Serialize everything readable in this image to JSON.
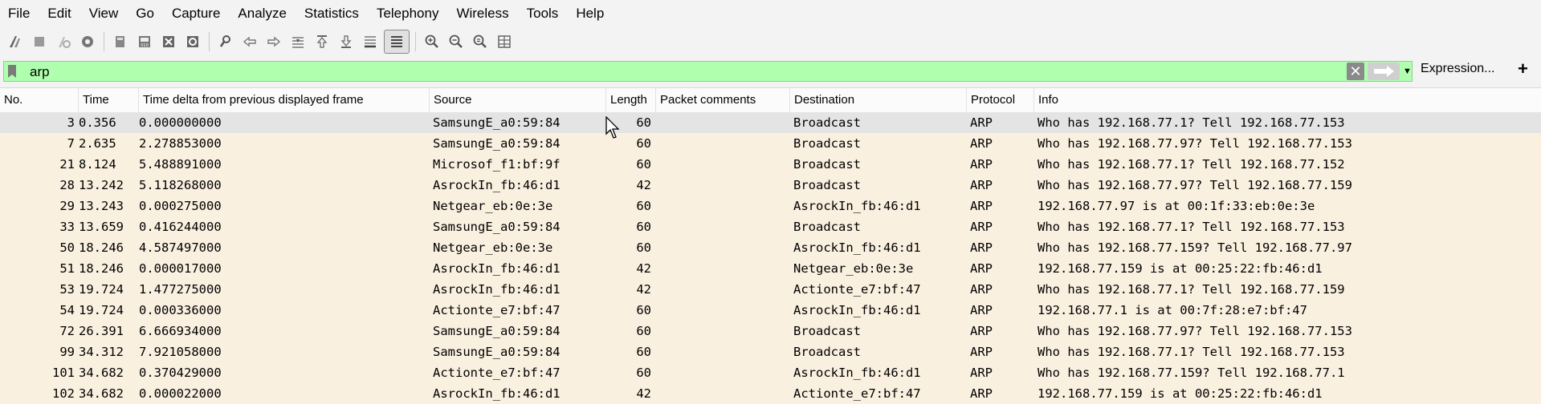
{
  "menu": [
    "File",
    "Edit",
    "View",
    "Go",
    "Capture",
    "Analyze",
    "Statistics",
    "Telephony",
    "Wireless",
    "Tools",
    "Help"
  ],
  "toolbar": {
    "icons": [
      "start-capture-icon",
      "stop-capture-icon",
      "restart-capture-icon",
      "capture-options-icon",
      "open-file-icon",
      "save-file-icon",
      "close-file-icon",
      "reload-file-icon",
      "find-packet-icon",
      "go-back-icon",
      "go-forward-icon",
      "go-to-packet-icon",
      "first-packet-icon",
      "last-packet-icon",
      "auto-scroll-icon",
      "colorize-icon",
      "zoom-in-icon",
      "zoom-out-icon",
      "normal-size-icon",
      "resize-columns-icon"
    ]
  },
  "filter": {
    "value": "arp",
    "expression_label": "Expression...",
    "add_label": "+",
    "clear_label": "✕",
    "background": "#afffaf"
  },
  "columns": {
    "no": "No.",
    "time": "Time",
    "delta": "Time delta from previous displayed frame",
    "source": "Source",
    "length": "Length",
    "comments": "Packet comments",
    "destination": "Destination",
    "protocol": "Protocol",
    "info": "Info"
  },
  "rows": [
    {
      "no": "3",
      "time": "0.356",
      "delta": "0.000000000",
      "source": "SamsungE_a0:59:84",
      "length": "60",
      "comments": "",
      "destination": "Broadcast",
      "protocol": "ARP",
      "info": "Who has 192.168.77.1? Tell 192.168.77.153"
    },
    {
      "no": "7",
      "time": "2.635",
      "delta": "2.278853000",
      "source": "SamsungE_a0:59:84",
      "length": "60",
      "comments": "",
      "destination": "Broadcast",
      "protocol": "ARP",
      "info": "Who has 192.168.77.97? Tell 192.168.77.153"
    },
    {
      "no": "21",
      "time": "8.124",
      "delta": "5.488891000",
      "source": "Microsof_f1:bf:9f",
      "length": "60",
      "comments": "",
      "destination": "Broadcast",
      "protocol": "ARP",
      "info": "Who has 192.168.77.1? Tell 192.168.77.152"
    },
    {
      "no": "28",
      "time": "13.242",
      "delta": "5.118268000",
      "source": "AsrockIn_fb:46:d1",
      "length": "42",
      "comments": "",
      "destination": "Broadcast",
      "protocol": "ARP",
      "info": "Who has 192.168.77.97? Tell 192.168.77.159"
    },
    {
      "no": "29",
      "time": "13.243",
      "delta": "0.000275000",
      "source": "Netgear_eb:0e:3e",
      "length": "60",
      "comments": "",
      "destination": "AsrockIn_fb:46:d1",
      "protocol": "ARP",
      "info": "192.168.77.97 is at 00:1f:33:eb:0e:3e"
    },
    {
      "no": "33",
      "time": "13.659",
      "delta": "0.416244000",
      "source": "SamsungE_a0:59:84",
      "length": "60",
      "comments": "",
      "destination": "Broadcast",
      "protocol": "ARP",
      "info": "Who has 192.168.77.1? Tell 192.168.77.153"
    },
    {
      "no": "50",
      "time": "18.246",
      "delta": "4.587497000",
      "source": "Netgear_eb:0e:3e",
      "length": "60",
      "comments": "",
      "destination": "AsrockIn_fb:46:d1",
      "protocol": "ARP",
      "info": "Who has 192.168.77.159? Tell 192.168.77.97"
    },
    {
      "no": "51",
      "time": "18.246",
      "delta": "0.000017000",
      "source": "AsrockIn_fb:46:d1",
      "length": "42",
      "comments": "",
      "destination": "Netgear_eb:0e:3e",
      "protocol": "ARP",
      "info": "192.168.77.159 is at 00:25:22:fb:46:d1"
    },
    {
      "no": "53",
      "time": "19.724",
      "delta": "1.477275000",
      "source": "AsrockIn_fb:46:d1",
      "length": "42",
      "comments": "",
      "destination": "Actionte_e7:bf:47",
      "protocol": "ARP",
      "info": "Who has 192.168.77.1? Tell 192.168.77.159"
    },
    {
      "no": "54",
      "time": "19.724",
      "delta": "0.000336000",
      "source": "Actionte_e7:bf:47",
      "length": "60",
      "comments": "",
      "destination": "AsrockIn_fb:46:d1",
      "protocol": "ARP",
      "info": "192.168.77.1 is at 00:7f:28:e7:bf:47"
    },
    {
      "no": "72",
      "time": "26.391",
      "delta": "6.666934000",
      "source": "SamsungE_a0:59:84",
      "length": "60",
      "comments": "",
      "destination": "Broadcast",
      "protocol": "ARP",
      "info": "Who has 192.168.77.97? Tell 192.168.77.153"
    },
    {
      "no": "99",
      "time": "34.312",
      "delta": "7.921058000",
      "source": "SamsungE_a0:59:84",
      "length": "60",
      "comments": "",
      "destination": "Broadcast",
      "protocol": "ARP",
      "info": "Who has 192.168.77.1? Tell 192.168.77.153"
    },
    {
      "no": "101",
      "time": "34.682",
      "delta": "0.370429000",
      "source": "Actionte_e7:bf:47",
      "length": "60",
      "comments": "",
      "destination": "AsrockIn_fb:46:d1",
      "protocol": "ARP",
      "info": "Who has 192.168.77.159? Tell 192.168.77.1"
    },
    {
      "no": "102",
      "time": "34.682",
      "delta": "0.000022000",
      "source": "AsrockIn_fb:46:d1",
      "length": "42",
      "comments": "",
      "destination": "Actionte_e7:bf:47",
      "protocol": "ARP",
      "info": "192.168.77.159 is at 00:25:22:fb:46:d1"
    }
  ],
  "colors": {
    "row_bg": "#faf0e0",
    "selected_row_bg": "#e4e4e4"
  }
}
